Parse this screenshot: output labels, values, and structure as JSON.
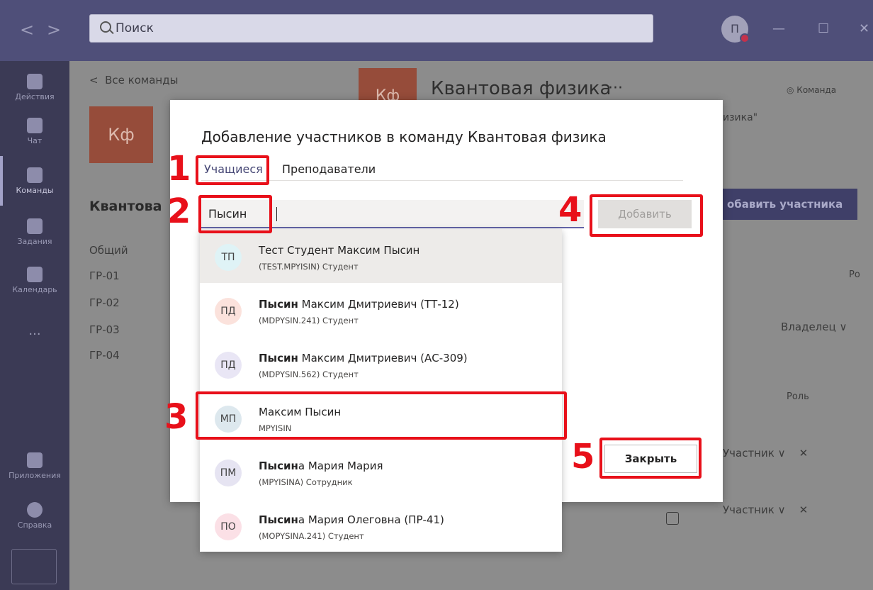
{
  "titlebar": {
    "search_placeholder": "Поиск",
    "avatar_initial": "П",
    "back_arrow": "<",
    "forward_arrow": ">",
    "minimize": "—",
    "maximize": "☐",
    "close": "✕"
  },
  "appbar": {
    "items": [
      {
        "label": "Действия",
        "icon": "bell-icon"
      },
      {
        "label": "Чат",
        "icon": "chat-icon"
      },
      {
        "label": "Команды",
        "icon": "teams-icon"
      },
      {
        "label": "Задания",
        "icon": "assignments-icon"
      },
      {
        "label": "Календарь",
        "icon": "calendar-icon"
      },
      {
        "label": "...",
        "icon": "more-icon"
      },
      {
        "label": "Приложения",
        "icon": "apps-icon"
      },
      {
        "label": "Справка",
        "icon": "help-icon"
      }
    ]
  },
  "background": {
    "back_link": "Все команды",
    "team_tile": "Кф",
    "team_name_short": "Квантова",
    "team_title": "Квантовая физика",
    "team_title_more": "···",
    "team_type": "Команда",
    "description_fragment": "изика\"",
    "channels": [
      "Общий",
      "ГР-01",
      "ГР-02",
      "ГР-03",
      "ГР-04"
    ],
    "add_member_button": "обавить участника",
    "role_header_1": "Ро",
    "owner_value": "Владелец",
    "role_header_2": "Роль",
    "member_role_1": "Участник",
    "member_role_2": "Участник"
  },
  "modal": {
    "title": "Добавление участников в команду Квантовая физика",
    "tabs": [
      "Учащиеся",
      "Преподаватели"
    ],
    "input_value": "Пысин",
    "add_button": "Добавить",
    "close_button": "Закрыть"
  },
  "suggestions": [
    {
      "initials": "ТП",
      "name_bold": "",
      "name_rest": "Тест Студент Максим Пысин",
      "sub": "(TEST.MPYISIN) Студент",
      "avatar_bg": "#dff3f6"
    },
    {
      "initials": "ПД",
      "name_bold": "Пысин",
      "name_rest": " Максим Дмитриевич (ТТ-12)",
      "sub": "(MDPYSIN.241) Студент",
      "avatar_bg": "#fbe2dc"
    },
    {
      "initials": "ПД",
      "name_bold": "Пысин",
      "name_rest": " Максим Дмитриевич (АС-309)",
      "sub": "(MDPYSIN.562) Студент",
      "avatar_bg": "#e9e6f5"
    },
    {
      "initials": "МП",
      "name_bold": "",
      "name_rest": "Максим Пысин",
      "sub": "MPYISIN",
      "avatar_bg": "#dde8ee"
    },
    {
      "initials": "ПМ",
      "name_bold": "Пысин",
      "name_rest": "а Мария Мария",
      "sub": "(MPYISINA) Сотрудник",
      "avatar_bg": "#e6e4f2"
    },
    {
      "initials": "ПО",
      "name_bold": "Пысин",
      "name_rest": "а Мария Олеговна (ПР-41)",
      "sub": "(MOPYSINA.241) Студент",
      "avatar_bg": "#fbe0e6"
    }
  ],
  "callouts": [
    "1",
    "2",
    "3",
    "4",
    "5"
  ]
}
